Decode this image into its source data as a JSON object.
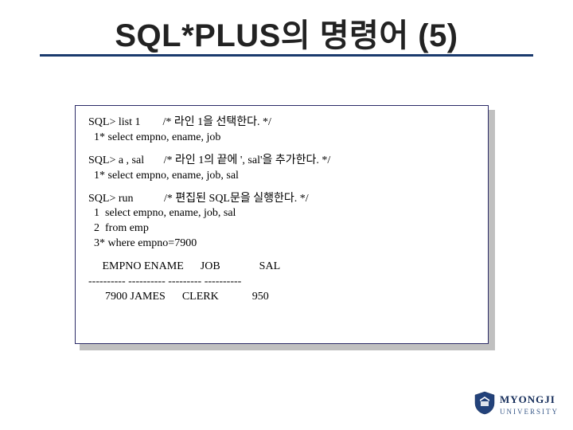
{
  "title": "SQL*PLUS의 명령어 (5)",
  "code": {
    "b1l1": "SQL> list 1        /* 라인 1을 선택한다. */",
    "b1l2": "  1* select empno, ename, job",
    "b2l1": "SQL> a , sal       /* 라인 1의 끝에 ', sal'을 추가한다. */",
    "b2l2": "  1* select empno, ename, job, sal",
    "b3l1": "SQL> run           /* 편집된 SQL문을 실행한다. */",
    "b3l2": "  1  select empno, ename, job, sal",
    "b3l3": "  2  from emp",
    "b3l4": "  3* where empno=7900",
    "b4l1": "     EMPNO ENAME      JOB              SAL",
    "b4l2": "---------- ---------- --------- ----------",
    "b4l3": "      7900 JAMES      CLERK            950"
  },
  "logo": {
    "main": "MYONGJI",
    "sub": "UNIVERSITY"
  }
}
